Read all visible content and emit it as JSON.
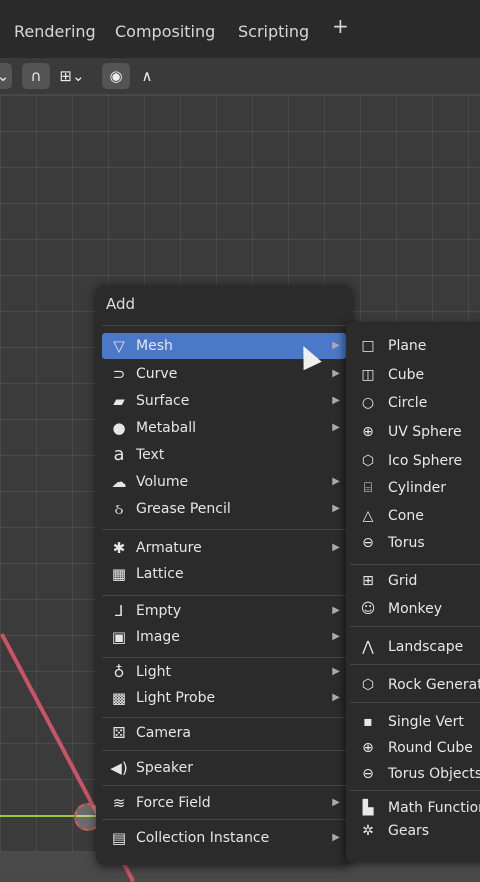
{
  "workspace_tabs": [
    "Rendering",
    "Compositing",
    "Scripting",
    "+"
  ],
  "header_tools": {
    "snap_icon": "magnet-icon",
    "snap_type_icon": "increment-icon",
    "proportional_icon": "circle-dot-icon",
    "falloff_icon": "falloff-curve-icon"
  },
  "add_menu": {
    "title": "Add",
    "items": [
      {
        "label": "Mesh",
        "icon": "mesh-icon",
        "submenu": true
      },
      {
        "label": "Curve",
        "icon": "curve-icon",
        "submenu": true
      },
      {
        "label": "Surface",
        "icon": "surface-icon",
        "submenu": true
      },
      {
        "label": "Metaball",
        "icon": "metaball-icon",
        "submenu": true
      },
      {
        "label": "Text",
        "icon": "text-icon",
        "submenu": false
      },
      {
        "label": "Volume",
        "icon": "volume-icon",
        "submenu": true
      },
      {
        "label": "Grease Pencil",
        "icon": "grease-pencil-icon",
        "submenu": true
      },
      {
        "label": "Armature",
        "icon": "armature-icon",
        "submenu": true
      },
      {
        "label": "Lattice",
        "icon": "lattice-icon",
        "submenu": false
      },
      {
        "label": "Empty",
        "icon": "empty-icon",
        "submenu": true
      },
      {
        "label": "Image",
        "icon": "image-icon",
        "submenu": true
      },
      {
        "label": "Light",
        "icon": "light-icon",
        "submenu": true
      },
      {
        "label": "Light Probe",
        "icon": "light-probe-icon",
        "submenu": true
      },
      {
        "label": "Camera",
        "icon": "camera-icon",
        "submenu": false
      },
      {
        "label": "Speaker",
        "icon": "speaker-icon",
        "submenu": false
      },
      {
        "label": "Force Field",
        "icon": "force-field-icon",
        "submenu": true
      },
      {
        "label": "Collection Instance",
        "icon": "collection-icon",
        "submenu": true
      }
    ]
  },
  "mesh_submenu": {
    "items": [
      {
        "label": "Plane",
        "icon": "plane-icon"
      },
      {
        "label": "Cube",
        "icon": "cube-icon"
      },
      {
        "label": "Circle",
        "icon": "circle-icon"
      },
      {
        "label": "UV Sphere",
        "icon": "uv-sphere-icon"
      },
      {
        "label": "Ico Sphere",
        "icon": "ico-sphere-icon"
      },
      {
        "label": "Cylinder",
        "icon": "cylinder-icon"
      },
      {
        "label": "Cone",
        "icon": "cone-icon"
      },
      {
        "label": "Torus",
        "icon": "torus-icon"
      },
      {
        "label": "Grid",
        "icon": "grid-icon"
      },
      {
        "label": "Monkey",
        "icon": "monkey-icon"
      },
      {
        "label": "Landscape",
        "icon": "landscape-icon"
      },
      {
        "label": "Rock Generat",
        "icon": "rock-icon"
      },
      {
        "label": "Single Vert",
        "icon": "vertex-icon"
      },
      {
        "label": "Round Cube",
        "icon": "round-cube-icon"
      },
      {
        "label": "Torus Objects",
        "icon": "torus-objects-icon"
      },
      {
        "label": "Math Function",
        "icon": "math-function-icon"
      },
      {
        "label": "Gears",
        "icon": "gears-icon"
      }
    ]
  },
  "colors": {
    "menu_bg": "#2b2b2b",
    "highlight": "#4b78c8",
    "axis_x": "#d9586b",
    "axis_y": "#9ac93a"
  }
}
